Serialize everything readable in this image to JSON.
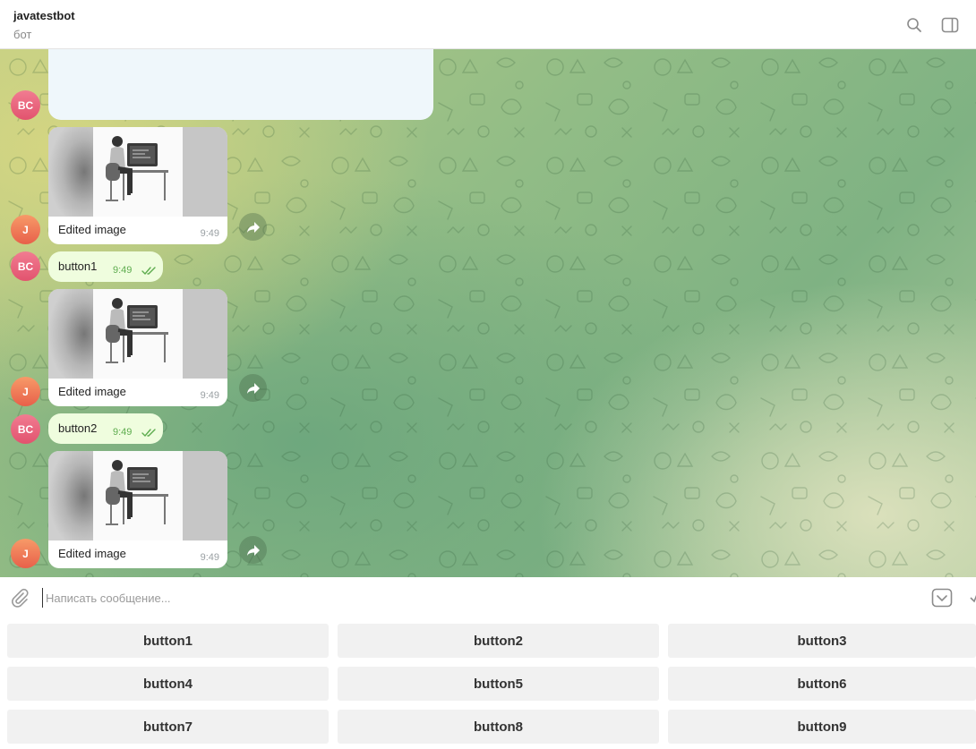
{
  "header": {
    "title": "javatestbot",
    "subtitle": "бот"
  },
  "icons": {
    "search": "search-icon",
    "side_panel": "side-panel-icon",
    "attach": "paperclip-icon",
    "keyboard": "keyboard-toggle-icon",
    "forward": "forward-arrow-icon",
    "read": "double-check-icon"
  },
  "colors": {
    "outgoing_bubble": "#effdde",
    "incoming_bubble": "#ffffff",
    "avatar_bc": "#e2536e",
    "avatar_j": "#e8604a",
    "time_out": "#5dac4e",
    "keyboard_button": "#f1f1f1"
  },
  "messages": {
    "avatar_bc": "BC",
    "avatar_j": "J",
    "photo1": {
      "caption": "Edited image",
      "time": "9:49"
    },
    "out1": {
      "text": "button1",
      "time": "9:49"
    },
    "photo2": {
      "caption": "Edited image",
      "time": "9:49"
    },
    "out2": {
      "text": "button2",
      "time": "9:49"
    },
    "photo3": {
      "caption": "Edited image",
      "time": "9:49"
    }
  },
  "input": {
    "placeholder": "Написать сообщение..."
  },
  "keyboard": {
    "b1": "button1",
    "b2": "button2",
    "b3": "button3",
    "b4": "button4",
    "b5": "button5",
    "b6": "button6",
    "b7": "button7",
    "b8": "button8",
    "b9": "button9"
  }
}
